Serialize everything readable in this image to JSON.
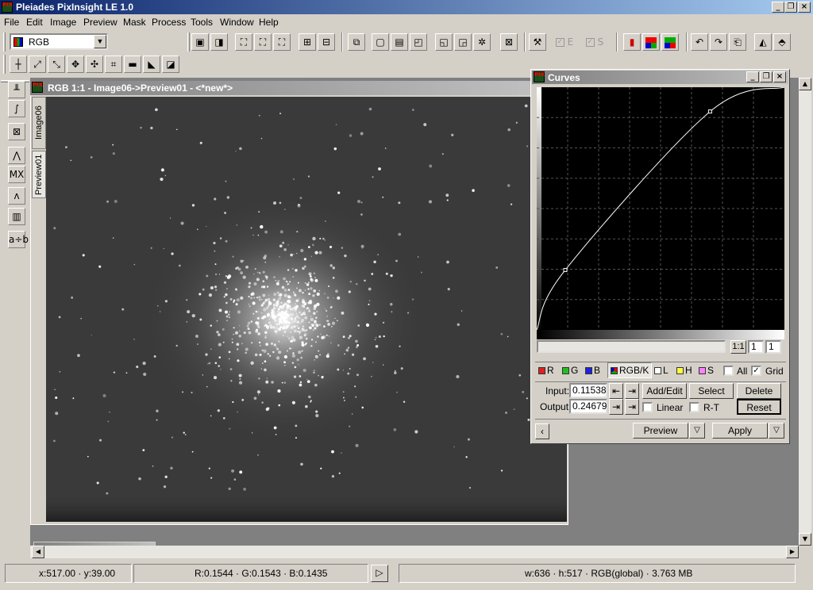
{
  "app": {
    "title": "Pleiades PixInsight LE 1.0",
    "icon_text": "PIX"
  },
  "window_controls": {
    "minimize": "_",
    "restore": "❐",
    "close": "×"
  },
  "menu": [
    "File",
    "Edit",
    "Image",
    "Preview",
    "Mask",
    "Process",
    "Tools",
    "Window",
    "Help"
  ],
  "toolbar": {
    "color_space": "RGB",
    "toggle_e": "E",
    "toggle_s": "S"
  },
  "image_window": {
    "title": "RGB 1:1 - Image06->Preview01 - <*new*>",
    "tabs": [
      "Image06",
      "Preview01"
    ]
  },
  "curves": {
    "title": "Curves",
    "zoom_label": "1:1",
    "zoom_h": "1",
    "zoom_v": "1",
    "channels": [
      {
        "label": "R",
        "color": "#e02020"
      },
      {
        "label": "G",
        "color": "#20c020"
      },
      {
        "label": "B",
        "color": "#2020e0"
      },
      {
        "label": "RGB/K",
        "color": "#404040"
      },
      {
        "label": "L",
        "color": "#ffffff"
      },
      {
        "label": "H",
        "color": "#ffff40"
      },
      {
        "label": "S",
        "color": "#ff80ff"
      }
    ],
    "all_label": "All",
    "grid_label": "Grid",
    "input_label": "Input:",
    "input_value": "0.11538",
    "output_label": "Output:",
    "output_value": "0.24679",
    "add_edit": "Add/Edit",
    "select": "Select",
    "delete": "Delete",
    "linear_label": "Linear",
    "rt_label": "R-T",
    "reset": "Reset",
    "preview": "Preview",
    "apply": "Apply",
    "curve_points": [
      [
        0,
        0
      ],
      [
        0.11538,
        0.24679
      ],
      [
        0.7,
        0.9
      ],
      [
        1,
        1
      ]
    ],
    "grid_on": true
  },
  "status": {
    "coords": "x:517.00 · y:39.00",
    "values": "R:0.1544 · G:0.1543 · B:0.1435",
    "info": "w:636 · h:517 · RGB(global) · 3.763 MB"
  }
}
